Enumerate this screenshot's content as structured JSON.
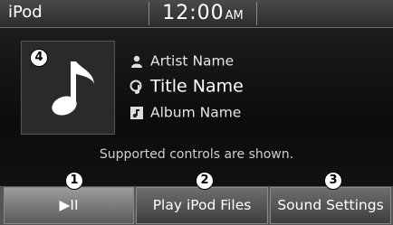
{
  "status_bar": {
    "source": "iPod",
    "time": "12:00",
    "ampm": "AM"
  },
  "now_playing": {
    "artist": "Artist Name",
    "title": "Title Name",
    "album": "Album Name",
    "artist_icon": "person-icon",
    "title_icon": "music-note-icon",
    "album_icon": "album-icon",
    "art_icon": "music-note-icon"
  },
  "message": "Supported controls are shown.",
  "buttons": {
    "play_pause": "▶II",
    "play_files": "Play iPod Files",
    "sound_settings": "Sound Settings"
  },
  "callouts": {
    "c1": "1",
    "c2": "2",
    "c3": "3",
    "c4": "4"
  }
}
